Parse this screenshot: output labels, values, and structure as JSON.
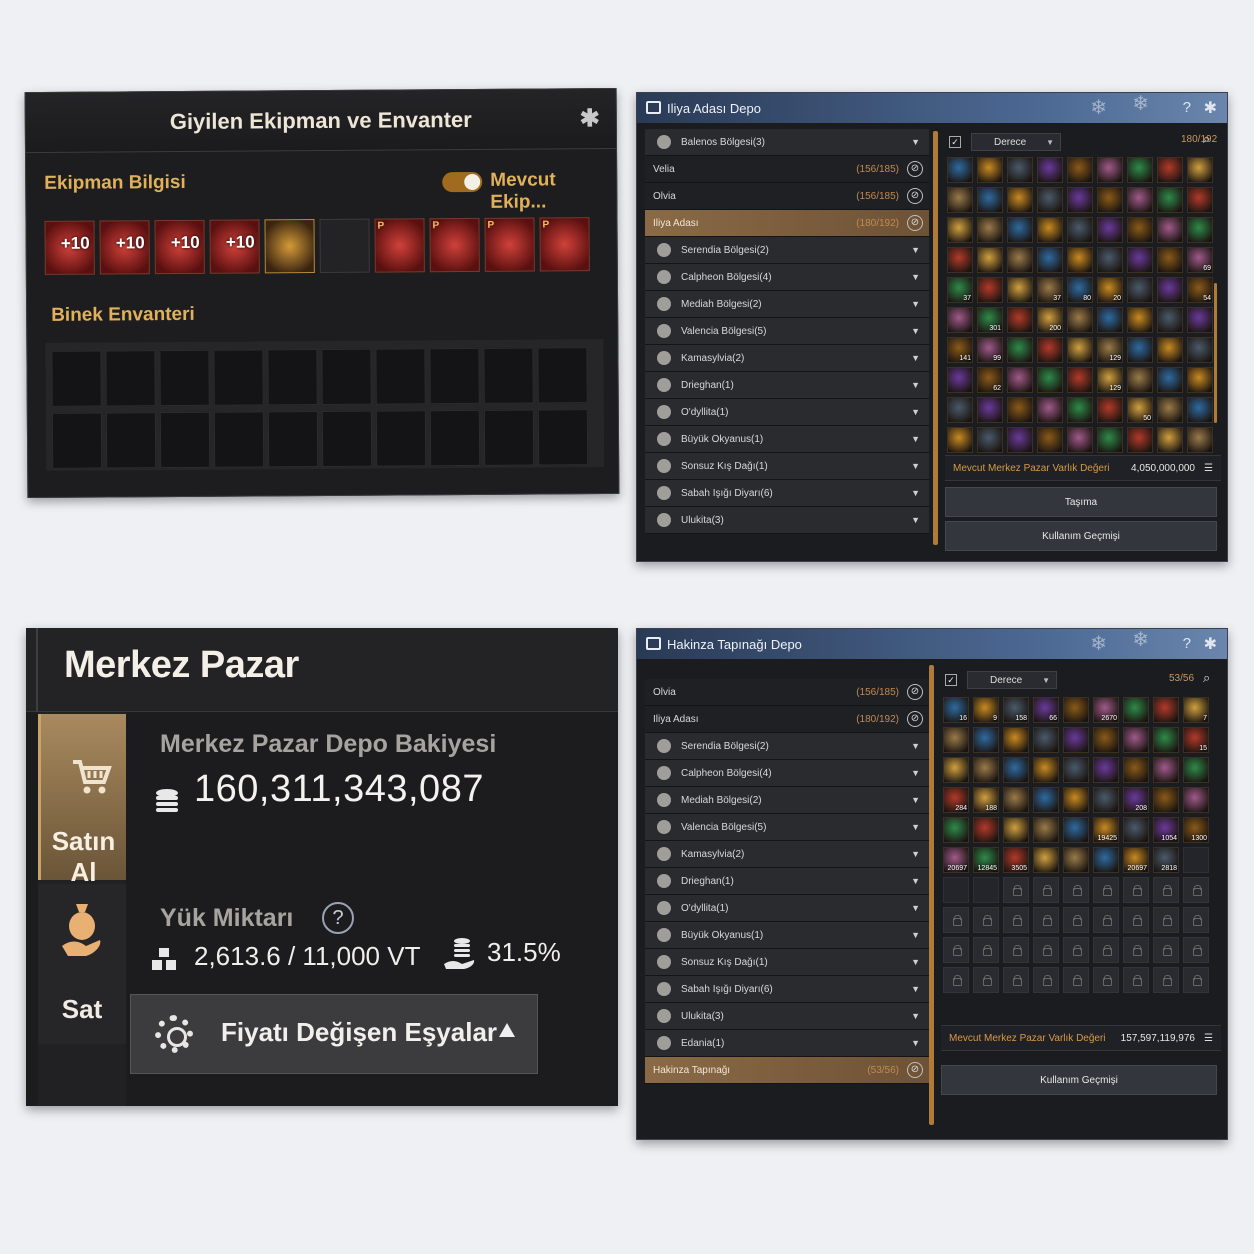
{
  "equipment_panel": {
    "title": "Giyilen Ekipman ve Envanter",
    "section_equipment": "Ekipman Bilgisi",
    "toggle_label": "Mevcut Ekip...",
    "toggle_on": true,
    "equipment_slots": [
      {
        "enhance": "+10",
        "kind": "red"
      },
      {
        "enhance": "+10",
        "kind": "red"
      },
      {
        "enhance": "+10",
        "kind": "red"
      },
      {
        "enhance": "+10",
        "kind": "red"
      },
      {
        "enhance": "",
        "kind": "gold"
      },
      {
        "enhance": "",
        "kind": "empty"
      },
      {
        "enhance": "",
        "kind": "red",
        "marker": "P"
      },
      {
        "enhance": "",
        "kind": "red",
        "marker": "P"
      },
      {
        "enhance": "",
        "kind": "red",
        "marker": "P"
      },
      {
        "enhance": "",
        "kind": "red",
        "marker": "P"
      }
    ],
    "section_mount": "Binek Envanteri"
  },
  "iliya_storage": {
    "title": "Iliya Adası Depo",
    "filter": {
      "checked": true,
      "sort_label": "Derece",
      "capacity": "180/192"
    },
    "regions": [
      {
        "name": "Balenos Bölgesi(3)",
        "type": "group"
      },
      {
        "name": "Velia",
        "count": "(156/185)",
        "type": "town"
      },
      {
        "name": "Olvia",
        "count": "(156/185)",
        "type": "town"
      },
      {
        "name": "Iliya Adası",
        "count": "(180/192)",
        "type": "selected"
      },
      {
        "name": "Serendia Bölgesi(2)",
        "type": "group"
      },
      {
        "name": "Calpheon Bölgesi(4)",
        "type": "group"
      },
      {
        "name": "Mediah Bölgesi(2)",
        "type": "group"
      },
      {
        "name": "Valencia Bölgesi(5)",
        "type": "group"
      },
      {
        "name": "Kamasylvia(2)",
        "type": "group"
      },
      {
        "name": "Drieghan(1)",
        "type": "group"
      },
      {
        "name": "O'dyllita(1)",
        "type": "group"
      },
      {
        "name": "Büyük Okyanus(1)",
        "type": "group"
      },
      {
        "name": "Sonsuz Kış Dağı(1)",
        "type": "group"
      },
      {
        "name": "Sabah Işığı Diyarı(6)",
        "type": "group"
      },
      {
        "name": "Ulukita(3)",
        "type": "group"
      }
    ],
    "item_counts": [
      "",
      "",
      "",
      "",
      "",
      "",
      "",
      "",
      "",
      "",
      "",
      "",
      "",
      "",
      "",
      "",
      "",
      "",
      "",
      "",
      "",
      "",
      "",
      "",
      "",
      "",
      "",
      "",
      "",
      "",
      "",
      "",
      "",
      "",
      "",
      "69",
      "37",
      "",
      "",
      "37",
      "80",
      "20",
      "",
      "",
      "54",
      "",
      "301",
      "",
      "200",
      "",
      "",
      "",
      "",
      "",
      "141",
      "99",
      "",
      "",
      "",
      "129",
      "",
      "",
      "",
      "",
      "62",
      "",
      "",
      "",
      "129",
      "",
      "",
      "",
      "",
      "",
      "",
      "",
      "",
      "",
      "50",
      "",
      "",
      "",
      "",
      "",
      "",
      "",
      ""
    ],
    "worth_label": "Mevcut Merkez Pazar Varlık Değeri",
    "worth_value": "4,050,000,000",
    "btn_transfer": "Taşıma",
    "btn_history": "Kullanım Geçmişi"
  },
  "market_panel": {
    "title": "Merkez Pazar",
    "tab_buy": "Satın Al",
    "tab_sell": "Sat",
    "balance_label": "Merkez Pazar Depo Bakiyesi",
    "balance_value": "160,311,343,087",
    "weight_label": "Yük Miktarı",
    "help_glyph": "?",
    "weight_value": "2,613.6 / 11,000 VT",
    "weight_percent": "31.5%",
    "price_change_label": "Fiyatı Değişen Eşyalar"
  },
  "hakinza_storage": {
    "title": "Hakinza Tapınağı Depo",
    "filter": {
      "checked": true,
      "sort_label": "Derece",
      "capacity": "53/56"
    },
    "regions": [
      {
        "name": "Olvia",
        "count": "(156/185)",
        "type": "town"
      },
      {
        "name": "Iliya Adası",
        "count": "(180/192)",
        "type": "town"
      },
      {
        "name": "Serendia Bölgesi(2)",
        "type": "group"
      },
      {
        "name": "Calpheon Bölgesi(4)",
        "type": "group"
      },
      {
        "name": "Mediah Bölgesi(2)",
        "type": "group"
      },
      {
        "name": "Valencia Bölgesi(5)",
        "type": "group"
      },
      {
        "name": "Kamasylvia(2)",
        "type": "group"
      },
      {
        "name": "Drieghan(1)",
        "type": "group"
      },
      {
        "name": "O'dyllita(1)",
        "type": "group"
      },
      {
        "name": "Büyük Okyanus(1)",
        "type": "group"
      },
      {
        "name": "Sonsuz Kış Dağı(1)",
        "type": "group"
      },
      {
        "name": "Sabah Işığı Diyarı(6)",
        "type": "group"
      },
      {
        "name": "Ulukita(3)",
        "type": "group"
      },
      {
        "name": "Edania(1)",
        "type": "group"
      },
      {
        "name": "Hakinza Tapınağı",
        "count": "(53/56)",
        "type": "selected"
      }
    ],
    "item_counts": [
      "16",
      "9",
      "158",
      "66",
      "",
      "2670",
      "",
      "",
      "7",
      "",
      "",
      "",
      "",
      "",
      "",
      "",
      "",
      "15",
      "",
      "",
      "",
      "",
      "",
      "",
      "",
      "",
      "",
      "284",
      "188",
      "",
      "",
      "",
      "",
      "208",
      "",
      "",
      "",
      "",
      "",
      "",
      "",
      "19425",
      "",
      "1054",
      "1300",
      "20697",
      "12845",
      "3505",
      "",
      "",
      "",
      "20697",
      "2818",
      ""
    ],
    "filled_slots": 53,
    "total_slots": 56,
    "worth_label": "Mevcut Merkez Pazar Varlık Değeri",
    "worth_value": "157,597,119,976",
    "btn_history": "Kullanım Geçmişi"
  }
}
